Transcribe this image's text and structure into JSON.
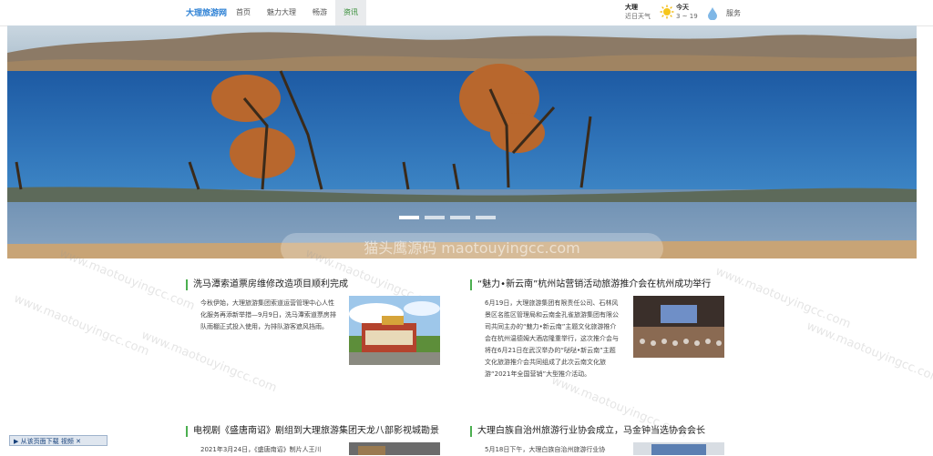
{
  "header": {
    "brand": "大理旅游网",
    "nav": [
      {
        "label": "首页",
        "active": false
      },
      {
        "label": "魅力大理",
        "active": false
      },
      {
        "label": "畅游",
        "active": false
      },
      {
        "label": "资讯",
        "active": true
      }
    ],
    "weather": {
      "city": "大理",
      "sub": "近日天气",
      "today_label": "今天",
      "temp": "3 ~ 19"
    },
    "service": "服务"
  },
  "hero": {
    "caption": "猫头鹰源码 maotouyingcc.com",
    "slide_count": 4,
    "active_slide": 0
  },
  "watermark": "www.maotouyingcc.com",
  "news": [
    {
      "title": "洗马潭索道票房维修改造项目顺利完成",
      "body": "今秋伊始，大理旅游集团索道运营管理中心人性化服务再添新举措—9月9日，洗马潭索道票房排队雨棚正式投入使用，为排队游客遮风挡雨。"
    },
    {
      "title": "“魅力•新云南”杭州站营销活动旅游推介会在杭州成功举行",
      "body": "6月19日，大理旅游集团有限责任公司、石林风景区名胜区管理局和云南金孔雀旅游集团有限公司共同主办的“魅力•新云南”主题文化旅游推介会在杭州温德姆大酒店隆重举行，这次推介会与将在6月21日在武汉举办的“哒哒•新云南”主题文化旅游推介会共同组成了此次云南文化旅游“2021年全国营销”大型推介活动。"
    },
    {
      "title": "电视剧《盛唐南诏》剧组到大理旅游集团天龙八部影视城勘景",
      "body": "2021年3月24日，《盛唐南诏》制片人王川"
    },
    {
      "title": "大理白族自治州旅游行业协会成立，马金钟当选协会会长",
      "body": "5月18日下午，大理白族自治州旅游行业协"
    }
  ],
  "download_bar": "从该页面下载 视频"
}
